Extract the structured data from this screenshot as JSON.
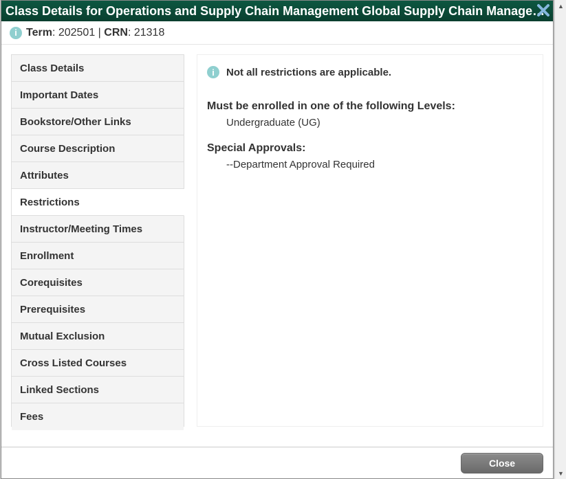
{
  "title": "Class Details for Operations and Supply Chain Management Global Supply Chain Manage…",
  "meta": {
    "term_label": "Term",
    "term_value": "202501",
    "sep": " | ",
    "crn_label": "CRN",
    "crn_value": "21318"
  },
  "tabs": [
    {
      "label": "Class Details",
      "active": false
    },
    {
      "label": "Important Dates",
      "active": false
    },
    {
      "label": "Bookstore/Other Links",
      "active": false
    },
    {
      "label": "Course Description",
      "active": false
    },
    {
      "label": "Attributes",
      "active": false
    },
    {
      "label": "Restrictions",
      "active": true
    },
    {
      "label": "Instructor/Meeting Times",
      "active": false
    },
    {
      "label": "Enrollment",
      "active": false
    },
    {
      "label": "Corequisites",
      "active": false
    },
    {
      "label": "Prerequisites",
      "active": false
    },
    {
      "label": "Mutual Exclusion",
      "active": false
    },
    {
      "label": "Cross Listed Courses",
      "active": false
    },
    {
      "label": "Linked Sections",
      "active": false
    },
    {
      "label": "Fees",
      "active": false
    }
  ],
  "content": {
    "notice": "Not all restrictions are applicable.",
    "levels_header": "Must be enrolled in one of the following Levels:",
    "levels_body": "Undergraduate (UG)",
    "approvals_header": "Special Approvals:",
    "approvals_body": "--Department Approval Required"
  },
  "footer": {
    "close": "Close"
  }
}
